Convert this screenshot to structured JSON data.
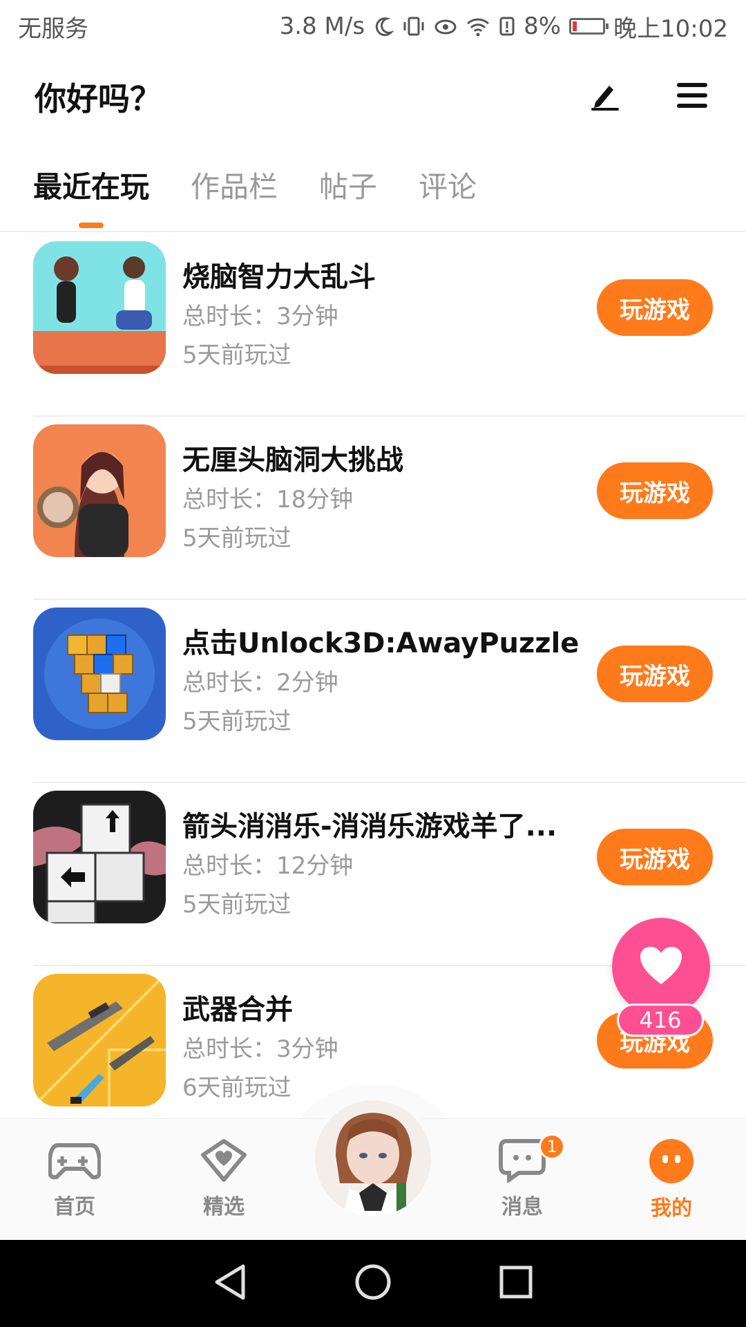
{
  "status_bar": {
    "carrier": "无服务",
    "speed": "3.8 M/s",
    "battery": "8%",
    "time": "晚上10:02",
    "icons": [
      "moon-icon",
      "vibrate-icon",
      "eye-icon",
      "wifi-icon",
      "alert-icon",
      "battery-icon"
    ]
  },
  "header": {
    "title": "你好吗？",
    "edit_icon": "pen-icon",
    "menu_icon": "menu-icon"
  },
  "tabs": [
    {
      "label": "最近在玩",
      "active": true
    },
    {
      "label": "作品栏",
      "active": false
    },
    {
      "label": "帖子",
      "active": false
    },
    {
      "label": "评论",
      "active": false
    }
  ],
  "games": [
    {
      "name": "烧脑智力大乱斗",
      "duration": "总时长：3分钟",
      "last_played": "5天前玩过",
      "button": "玩游戏"
    },
    {
      "name": "无厘头脑洞大挑战",
      "duration": "总时长：18分钟",
      "last_played": "5天前玩过",
      "button": "玩游戏"
    },
    {
      "name": "点击Unlock3D:AwayPuzzle",
      "duration": "总时长：2分钟",
      "last_played": "5天前玩过",
      "button": "玩游戏"
    },
    {
      "name": "箭头消消乐-消消乐游戏羊了...",
      "duration": "总时长：12分钟",
      "last_played": "5天前玩过",
      "button": "玩游戏"
    },
    {
      "name": "武器合并",
      "duration": "总时长：3分钟",
      "last_played": "6天前玩过",
      "button": "玩游戏"
    }
  ],
  "like_fab": {
    "count": "416",
    "icon": "heart-icon"
  },
  "bottom_nav": {
    "items": [
      {
        "label": "首页",
        "icon": "gamepad-icon"
      },
      {
        "label": "精选",
        "icon": "heart-badge-icon"
      },
      {
        "label": "消息",
        "icon": "chat-icon",
        "badge": "1"
      },
      {
        "label": "我的",
        "icon": "profile-face-icon",
        "active": true
      }
    ]
  },
  "system_nav": {
    "icons": [
      "back-icon",
      "home-icon",
      "recents-icon"
    ]
  },
  "colors": {
    "accent": "#ff7a1a",
    "like": "#ff4f93",
    "muted": "#9a9a9a"
  }
}
